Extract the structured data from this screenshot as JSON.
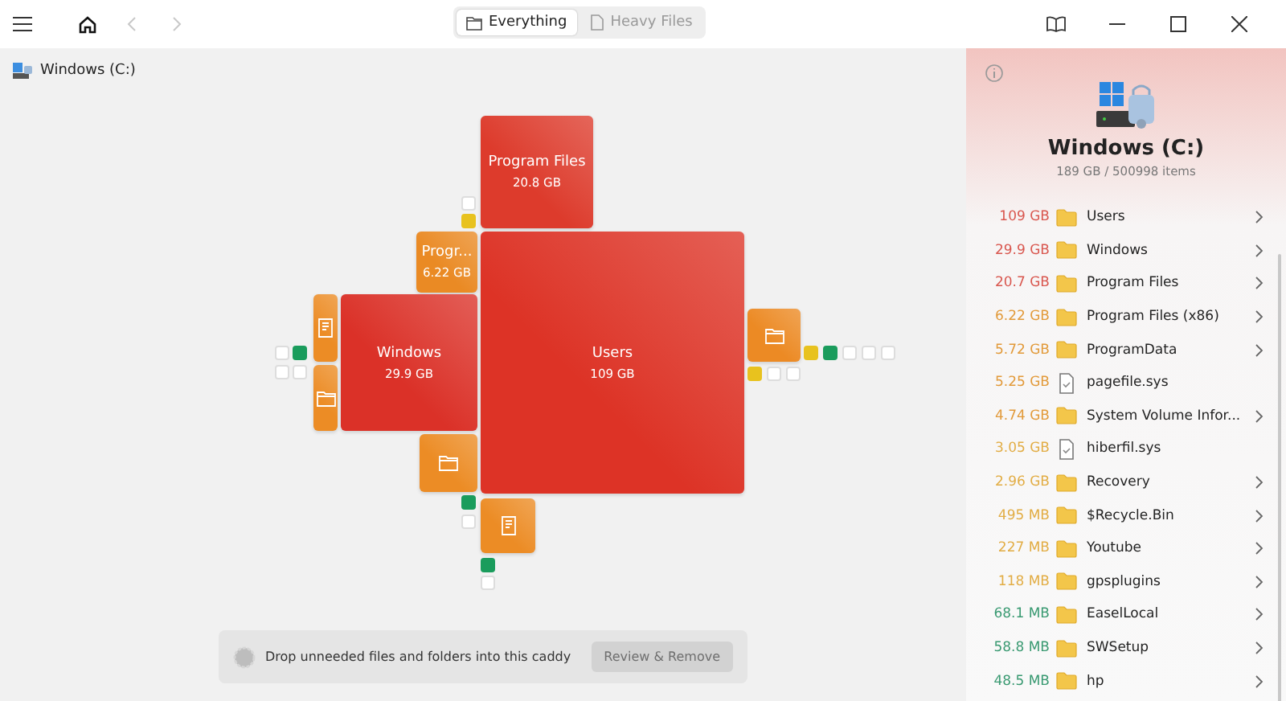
{
  "toolbar": {
    "back": {
      "disabled": true
    },
    "forward": {
      "disabled": true
    },
    "tabs": [
      {
        "label": "Everything",
        "kind": "folder",
        "selected": true
      },
      {
        "label": "Heavy Files",
        "kind": "file",
        "selected": false
      }
    ]
  },
  "breadcrumb": "Windows (C:)",
  "treemap": {
    "blocks": [
      {
        "kind": "labeled",
        "name": "Program Files",
        "size": "20.8 GB",
        "color": "#dd3b2c"
      },
      {
        "kind": "labeled",
        "name": "Progr...",
        "size": "6.22 GB",
        "color": "#ea8a24"
      },
      {
        "kind": "file",
        "color": "#ec8c25"
      },
      {
        "kind": "folder",
        "color": "#ec8c25"
      },
      {
        "kind": "labeled",
        "name": "Windows",
        "size": "29.9 GB",
        "color": "#db3128"
      },
      {
        "kind": "labeled",
        "name": "Users",
        "size": "109 GB",
        "color": "#dd3326"
      },
      {
        "kind": "folder",
        "color": "#ec8a24"
      },
      {
        "kind": "folder",
        "color": "#ec8c25"
      },
      {
        "kind": "file",
        "color": "#ec8c25"
      }
    ],
    "markers": [
      {
        "color": "#ffffff"
      },
      {
        "color": "#e8c21e"
      },
      {
        "color": "#ffffff"
      },
      {
        "color": "#1a9c5c"
      },
      {
        "color": "#ffffff"
      },
      {
        "color": "#ffffff"
      },
      {
        "color": "#e8c21e"
      },
      {
        "color": "#1a9c5c"
      },
      {
        "color": "#ffffff"
      },
      {
        "color": "#ffffff"
      },
      {
        "color": "#ffffff"
      },
      {
        "color": "#e8c21e"
      },
      {
        "color": "#ffffff"
      },
      {
        "color": "#ffffff"
      },
      {
        "color": "#1a9c5c"
      },
      {
        "color": "#ffffff"
      },
      {
        "color": "#1a9c5c"
      },
      {
        "color": "#ffffff"
      }
    ]
  },
  "caddy": {
    "text": "Drop unneeded files and folders into this caddy",
    "button": {
      "label": "Review & Remove",
      "disabled": true
    }
  },
  "panel": {
    "title": "Windows (C:)",
    "subtitle": "189 GB / 500998 items",
    "items": [
      {
        "size": "109 GB",
        "color": "#d9574f",
        "kind": "folder",
        "name": "Users",
        "expandable": true
      },
      {
        "size": "29.9 GB",
        "color": "#d9574f",
        "kind": "folder",
        "name": "Windows",
        "expandable": true
      },
      {
        "size": "20.7 GB",
        "color": "#d9574f",
        "kind": "folder",
        "name": "Program Files",
        "expandable": true
      },
      {
        "size": "6.22 GB",
        "color": "#e29a3a",
        "kind": "folder",
        "name": "Program Files (x86)",
        "expandable": true
      },
      {
        "size": "5.72 GB",
        "color": "#e29a3a",
        "kind": "folder",
        "name": "ProgramData",
        "expandable": true
      },
      {
        "size": "5.25 GB",
        "color": "#e29a3a",
        "kind": "file",
        "name": "pagefile.sys",
        "expandable": false
      },
      {
        "size": "4.74 GB",
        "color": "#e29a3a",
        "kind": "folder",
        "name": "System Volume Infor...",
        "expandable": true
      },
      {
        "size": "3.05 GB",
        "color": "#e2ad45",
        "kind": "file",
        "name": "hiberfil.sys",
        "expandable": false
      },
      {
        "size": "2.96 GB",
        "color": "#e2ad45",
        "kind": "folder",
        "name": "Recovery",
        "expandable": true
      },
      {
        "size": "495 MB",
        "color": "#e2ad45",
        "kind": "folder",
        "name": "$Recycle.Bin",
        "expandable": true
      },
      {
        "size": "227 MB",
        "color": "#e2ad45",
        "kind": "folder",
        "name": "Youtube",
        "expandable": true
      },
      {
        "size": "118 MB",
        "color": "#e2ad45",
        "kind": "folder",
        "name": "gpsplugins",
        "expandable": true
      },
      {
        "size": "68.1 MB",
        "color": "#3a9a72",
        "kind": "folder",
        "name": "EaselLocal",
        "expandable": true
      },
      {
        "size": "58.8 MB",
        "color": "#3a9a72",
        "kind": "folder",
        "name": "SWSetup",
        "expandable": true
      },
      {
        "size": "48.5 MB",
        "color": "#3a9a72",
        "kind": "folder",
        "name": "hp",
        "expandable": true
      }
    ]
  }
}
